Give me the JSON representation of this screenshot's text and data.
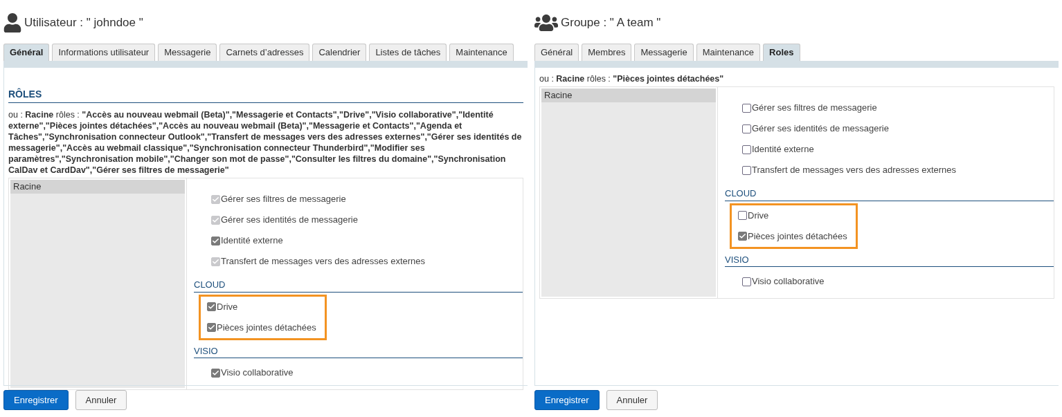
{
  "panels": [
    {
      "kind": "user",
      "title": "Utilisateur : \" johndoe \"",
      "tabs": [
        {
          "label": "Général",
          "selected": true
        },
        {
          "label": "Informations utilisateur",
          "selected": false
        },
        {
          "label": "Messagerie",
          "selected": false
        },
        {
          "label": "Carnets d’adresses",
          "selected": false
        },
        {
          "label": "Calendrier",
          "selected": false
        },
        {
          "label": "Listes de tâches",
          "selected": false
        },
        {
          "label": "Maintenance",
          "selected": false
        }
      ],
      "section_title": "RÔLES",
      "roles_info": "ou : **Racine** rôles : **\"Accès au nouveau webmail (Beta)\",\"Messagerie et Contacts\",\"Drive\",\"Visio collaborative\",\"Identité externe\",\"Pièces jointes détachées\",\"Accès au nouveau webmail (Beta)\",\"Messagerie et Contacts\",\"Agenda et Tâches\",\"Synchronisation connecteur Outlook\",\"Transfert de messages vers des adresses externes\",\"Gérer ses identités de messagerie\",\"Accès au webmail classique\",\"Synchronisation connecteur Thunderbird\",\"Modifier ses paramètres\",\"Synchronisation mobile\",\"Changer son mot de passe\",\"Consulter les filtres du domaine\",\"Synchronisation CalDav et CardDav\",\"Gérer ses filtres de messagerie\"**",
      "tree": [
        {
          "label": "Racine",
          "selected": true
        }
      ],
      "groups": [
        {
          "items": [
            {
              "label": "Gérer ses filtres de messagerie",
              "checked": true,
              "disabled": true
            },
            {
              "label": "Gérer ses identités de messagerie",
              "checked": true,
              "disabled": true
            },
            {
              "label": "Identité externe",
              "checked": true,
              "disabled": false
            },
            {
              "label": "Transfert de messages vers des adresses externes",
              "checked": true,
              "disabled": true
            }
          ]
        },
        {
          "title": "CLOUD",
          "highlight": true,
          "items": [
            {
              "label": "Drive",
              "checked": true,
              "disabled": false
            },
            {
              "label": "Pièces jointes détachées",
              "checked": true,
              "disabled": false
            }
          ]
        },
        {
          "title": "VISIO",
          "items": [
            {
              "label": "Visio collaborative",
              "checked": true,
              "disabled": false
            }
          ]
        }
      ],
      "buttons": [
        {
          "label": "Enregistrer",
          "kind": "primary"
        },
        {
          "label": "Annuler",
          "kind": "secondary"
        }
      ]
    },
    {
      "kind": "group",
      "title": "Groupe : \" A team \"",
      "tabs": [
        {
          "label": "Général",
          "selected": false
        },
        {
          "label": "Membres",
          "selected": false
        },
        {
          "label": "Messagerie",
          "selected": false
        },
        {
          "label": "Maintenance",
          "selected": false
        },
        {
          "label": "Roles",
          "selected": true
        }
      ],
      "roles_info": "ou : **Racine** rôles : **\"Pièces jointes détachées\"**",
      "tree": [
        {
          "label": "Racine",
          "selected": true
        }
      ],
      "groups": [
        {
          "items": [
            {
              "label": "Gérer ses filtres de messagerie",
              "checked": false,
              "disabled": false
            },
            {
              "label": "Gérer ses identités de messagerie",
              "checked": false,
              "disabled": false
            },
            {
              "label": "Identité externe",
              "checked": false,
              "disabled": false
            },
            {
              "label": "Transfert de messages vers des adresses externes",
              "checked": false,
              "disabled": false
            }
          ]
        },
        {
          "title": "CLOUD",
          "highlight": true,
          "items": [
            {
              "label": "Drive",
              "checked": false,
              "disabled": false
            },
            {
              "label": "Pièces jointes détachées",
              "checked": true,
              "disabled": false
            }
          ]
        },
        {
          "title": "VISIO",
          "items": [
            {
              "label": "Visio collaborative",
              "checked": false,
              "disabled": false
            }
          ]
        }
      ],
      "buttons": [
        {
          "label": "Enregistrer",
          "kind": "primary"
        },
        {
          "label": "Annuler",
          "kind": "secondary"
        }
      ]
    }
  ]
}
